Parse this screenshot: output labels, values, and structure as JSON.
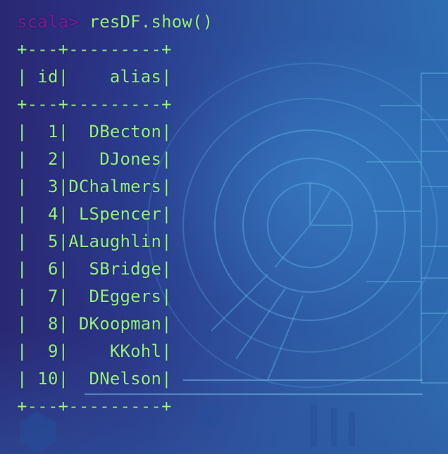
{
  "terminal": {
    "prompt": "scala>",
    "command": "resDF.show()",
    "border": "+---+---------+",
    "header": "| id|    alias|",
    "rows": [
      "|  1|  DBecton|",
      "|  2|   DJones|",
      "|  3|DChalmers|",
      "|  4| LSpencer|",
      "|  5|ALaughlin|",
      "|  6|  SBridge|",
      "|  7|  DEggers|",
      "|  8| DKoopman|",
      "|  9|    KKohl|",
      "| 10|  DNelson|"
    ]
  },
  "colors": {
    "text": "#9cf58d",
    "prompt": "#7a1b9a",
    "background": "#2b3486"
  }
}
